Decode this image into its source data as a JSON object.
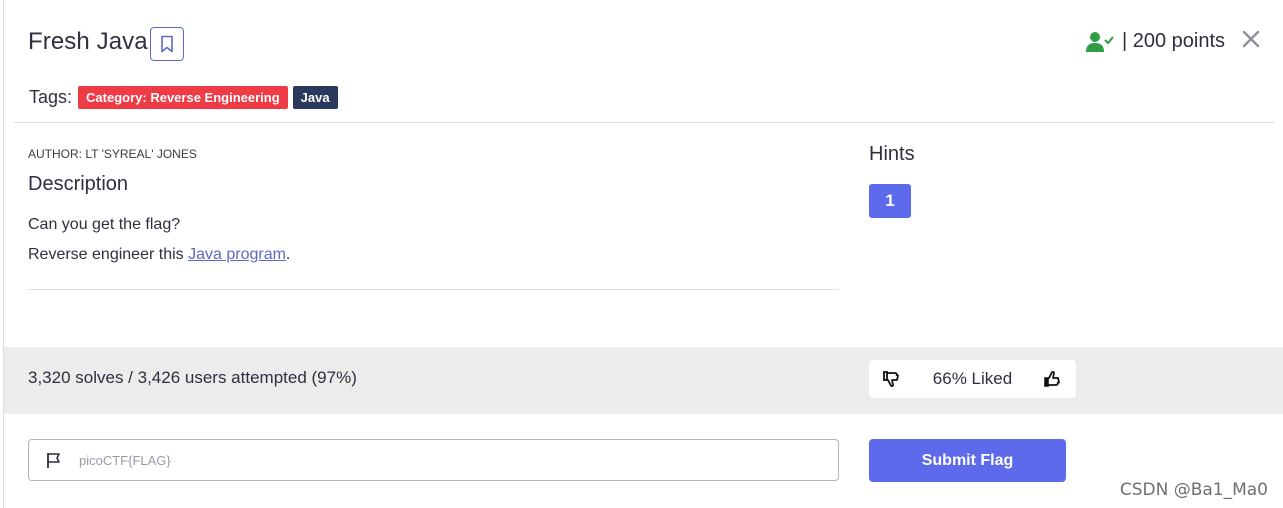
{
  "challenge": {
    "title": "Fresh Java",
    "points_text": "| 200 points"
  },
  "tags": {
    "label": "Tags:",
    "items": [
      "Category: Reverse Engineering",
      "Java"
    ]
  },
  "description": {
    "author": "AUTHOR: LT 'SYREAL' JONES",
    "heading": "Description",
    "line1": "Can you get the flag?",
    "line2_prefix": "Reverse engineer this ",
    "line2_link": "Java program",
    "line2_suffix": "."
  },
  "hints": {
    "heading": "Hints",
    "items": [
      "1"
    ]
  },
  "stats": {
    "solves_text": "3,320 solves / 3,426 users attempted (97%)",
    "liked_text": "66% Liked"
  },
  "flag_form": {
    "placeholder": "picoCTF{FLAG}",
    "value": "",
    "submit_label": "Submit Flag"
  },
  "watermark": "CSDN @Ba1_Ma0",
  "colors": {
    "accent": "#5c6aeb",
    "category_tag": "#ee3b46",
    "language_tag": "#2b3a5c",
    "solved_icon": "#2f9e44",
    "stats_band": "#ececec"
  },
  "icons": {
    "bookmark": "bookmark-icon",
    "solved": "user-check-icon",
    "close": "close-icon",
    "dislike": "thumbs-down-icon",
    "like": "thumbs-up-icon",
    "flag": "flag-icon"
  }
}
